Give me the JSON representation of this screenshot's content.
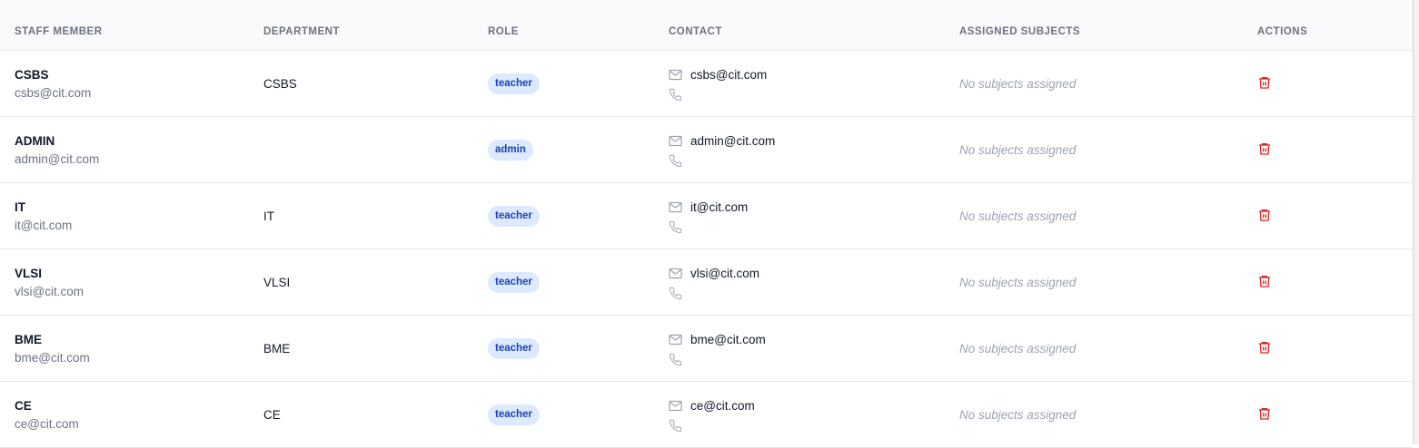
{
  "headers": {
    "staff": "Staff Member",
    "department": "Department",
    "role": "Role",
    "contact": "Contact",
    "subjects": "Assigned Subjects",
    "actions": "Actions"
  },
  "rows": [
    {
      "name": "CSBS",
      "email": "csbs@cit.com",
      "department": "CSBS",
      "role": "teacher",
      "contact_email": "csbs@cit.com",
      "subjects": "No subjects assigned"
    },
    {
      "name": "ADMIN",
      "email": "admin@cit.com",
      "department": "",
      "role": "admin",
      "contact_email": "admin@cit.com",
      "subjects": "No subjects assigned"
    },
    {
      "name": "IT",
      "email": "it@cit.com",
      "department": "IT",
      "role": "teacher",
      "contact_email": "it@cit.com",
      "subjects": "No subjects assigned"
    },
    {
      "name": "VLSI",
      "email": "vlsi@cit.com",
      "department": "VLSI",
      "role": "teacher",
      "contact_email": "vlsi@cit.com",
      "subjects": "No subjects assigned"
    },
    {
      "name": "BME",
      "email": "bme@cit.com",
      "department": "BME",
      "role": "teacher",
      "contact_email": "bme@cit.com",
      "subjects": "No subjects assigned"
    },
    {
      "name": "CE",
      "email": "ce@cit.com",
      "department": "CE",
      "role": "teacher",
      "contact_email": "ce@cit.com",
      "subjects": "No subjects assigned"
    }
  ],
  "colors": {
    "badge_bg": "#dbeafe",
    "badge_text": "#1e40af",
    "delete": "#dc2626"
  }
}
